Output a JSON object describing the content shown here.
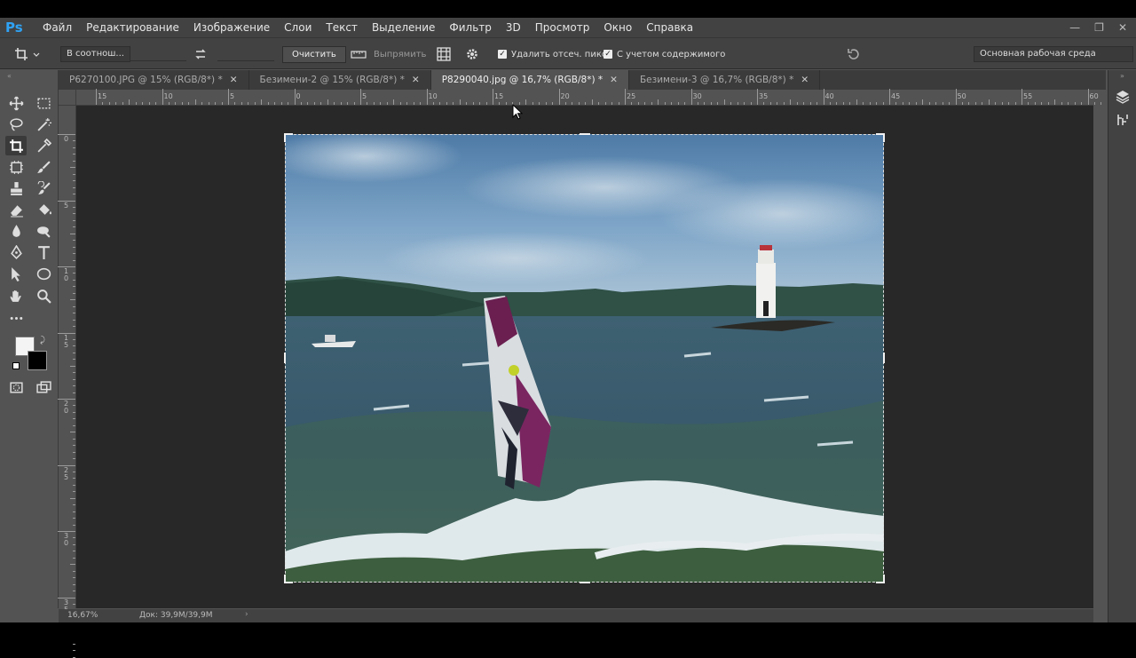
{
  "app": {
    "logo": "Ps"
  },
  "menu": [
    "Файл",
    "Редактирование",
    "Изображение",
    "Слои",
    "Текст",
    "Выделение",
    "Фильтр",
    "3D",
    "Просмотр",
    "Окно",
    "Справка"
  ],
  "window_controls": {
    "minimize": "—",
    "restore": "❐",
    "close": "✕"
  },
  "options": {
    "ratio_select": "В соотнош...",
    "clear_button": "Очистить",
    "straighten_label": "Выпрямить",
    "delete_cropped": "Удалить отсеч. пикс.",
    "content_aware": "С учетом содержимого",
    "workspace": "Основная рабочая среда"
  },
  "tabs": [
    {
      "label": "P6270100.JPG @ 15% (RGB/8*) *",
      "active": false
    },
    {
      "label": "Безимени-2 @ 15% (RGB/8*) *",
      "active": false
    },
    {
      "label": "P8290040.jpg @ 16,7% (RGB/8*) *",
      "active": true
    },
    {
      "label": "Безимени-3 @ 16,7% (RGB/8*) *",
      "active": false
    }
  ],
  "ruler_top": [
    "15",
    "10",
    "5",
    "0",
    "5",
    "10",
    "15",
    "20",
    "25",
    "30",
    "35",
    "40",
    "45",
    "50",
    "55",
    "60"
  ],
  "ruler_left": [
    "0",
    "5",
    "1\n0",
    "1\n5",
    "2\n0",
    "2\n5",
    "3\n0",
    "3\n5"
  ],
  "status": {
    "zoom": "16,67%",
    "doc": "Док: 39,9M/39,9M"
  },
  "colors": {
    "accent": "#2fa3f5",
    "panel": "#535353",
    "canvas_bg": "#282828",
    "menubar": "#424242"
  },
  "icons": [
    "move-icon",
    "marquee-icon",
    "lasso-icon",
    "magic-wand-icon",
    "crop-icon",
    "eyedropper-icon",
    "frame-icon",
    "brush-icon",
    "stamp-icon",
    "history-brush-icon",
    "eraser-icon",
    "paint-bucket-icon",
    "blur-icon",
    "dodge-icon",
    "pen-icon",
    "type-icon",
    "path-select-icon",
    "ellipse-icon",
    "hand-icon",
    "zoom-icon",
    "more-icon"
  ]
}
